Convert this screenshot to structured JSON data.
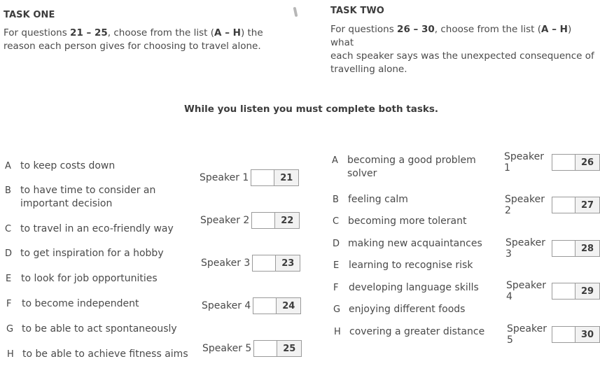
{
  "task_one": {
    "title": "TASK ONE",
    "instr_pre": "For questions ",
    "instr_range": "21 – 25",
    "instr_mid": ", choose from the list (",
    "instr_letters": "A – H",
    "instr_post_line1": ") the",
    "instr_line2": "reason each person gives for choosing to travel alone.",
    "options": [
      {
        "letter": "A",
        "text": "to keep costs down"
      },
      {
        "letter": "B",
        "text": "to have time to consider an",
        "cont": "important decision"
      },
      {
        "letter": "C",
        "text": "to travel in an eco-friendly way"
      },
      {
        "letter": "D",
        "text": "to get inspiration for a hobby"
      },
      {
        "letter": "E",
        "text": "to look for job opportunities"
      },
      {
        "letter": "F",
        "text": "to become independent"
      },
      {
        "letter": "G",
        "text": "to be able to act spontaneously"
      },
      {
        "letter": "H",
        "text": "to be able to achieve fitness aims"
      }
    ],
    "speakers": [
      {
        "label": "Speaker 1",
        "question": "21",
        "answer": ""
      },
      {
        "label": "Speaker 2",
        "question": "22",
        "answer": ""
      },
      {
        "label": "Speaker 3",
        "question": "23",
        "answer": ""
      },
      {
        "label": "Speaker 4",
        "question": "24",
        "answer": ""
      },
      {
        "label": "Speaker 5",
        "question": "25",
        "answer": ""
      }
    ]
  },
  "task_two": {
    "title": "TASK TWO",
    "instr_pre": "For questions ",
    "instr_range": "26 – 30",
    "instr_mid": ", choose from the list (",
    "instr_letters": "A – H",
    "instr_post_line1": ") what",
    "instr_line2": "each speaker says was the unexpected consequence of",
    "instr_line3": "travelling alone.",
    "options": [
      {
        "letter": "A",
        "text": "becoming a good problem",
        "cont": "solver"
      },
      {
        "letter": "B",
        "text": "feeling calm"
      },
      {
        "letter": "C",
        "text": "becoming more tolerant"
      },
      {
        "letter": "D",
        "text": "making new acquaintances"
      },
      {
        "letter": "E",
        "text": "learning to recognise risk"
      },
      {
        "letter": "F",
        "text": "developing language skills"
      },
      {
        "letter": "G",
        "text": "enjoying different foods"
      },
      {
        "letter": "H",
        "text": "covering a greater distance"
      }
    ],
    "speakers": [
      {
        "label": "Speaker 1",
        "question": "26",
        "answer": ""
      },
      {
        "label": "Speaker 2",
        "question": "27",
        "answer": ""
      },
      {
        "label": "Speaker 3",
        "question": "28",
        "answer": ""
      },
      {
        "label": "Speaker 4",
        "question": "29",
        "answer": ""
      },
      {
        "label": "Speaker 5",
        "question": "30",
        "answer": ""
      }
    ]
  },
  "centre_instruction": "While you listen you must complete both tasks."
}
